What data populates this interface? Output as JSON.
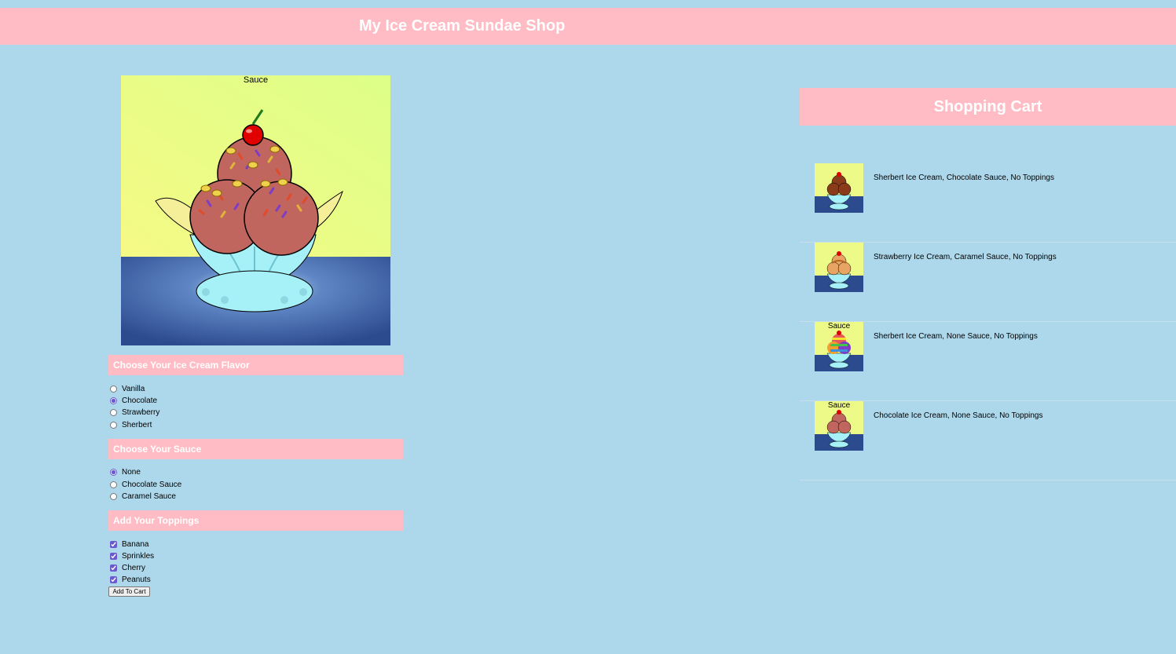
{
  "header": {
    "title": "My Ice Cream Sundae Shop"
  },
  "preview": {
    "alt": "Sauce"
  },
  "flavor": {
    "heading": "Choose Your Ice Cream Flavor",
    "options": [
      "Vanilla",
      "Chocolate",
      "Strawberry",
      "Sherbert"
    ],
    "selected": "Chocolate"
  },
  "sauce": {
    "heading": "Choose Your Sauce",
    "options": [
      "None",
      "Chocolate Sauce",
      "Caramel Sauce"
    ],
    "selected": "None"
  },
  "toppings": {
    "heading": "Add Your Toppings",
    "options": [
      "Banana",
      "Sprinkles",
      "Cherry",
      "Peanuts"
    ],
    "checked": [
      true,
      true,
      true,
      true
    ]
  },
  "add_button": "Add To Cart",
  "cart": {
    "title": "Shopping Cart",
    "items": [
      {
        "desc": "Sherbert Ice Cream, Chocolate Sauce, No Toppings",
        "alt": ""
      },
      {
        "desc": "Strawberry Ice Cream, Caramel Sauce, No Toppings",
        "alt": ""
      },
      {
        "desc": "Sherbert Ice Cream, None Sauce, No Toppings",
        "alt": "Sauce"
      },
      {
        "desc": "Chocolate Ice Cream, None Sauce, No Toppings",
        "alt": "Sauce"
      }
    ]
  },
  "colors": {
    "background": "#add8ec",
    "accent": "#ffbcc4",
    "wall": "#eefa88",
    "table": "#2c4a8e",
    "bowl": "#a6f1f7",
    "chocolate": "#c0665e",
    "strawberry": "#e7a463",
    "cherry": "#e00000",
    "banana": "#f4ef98"
  }
}
